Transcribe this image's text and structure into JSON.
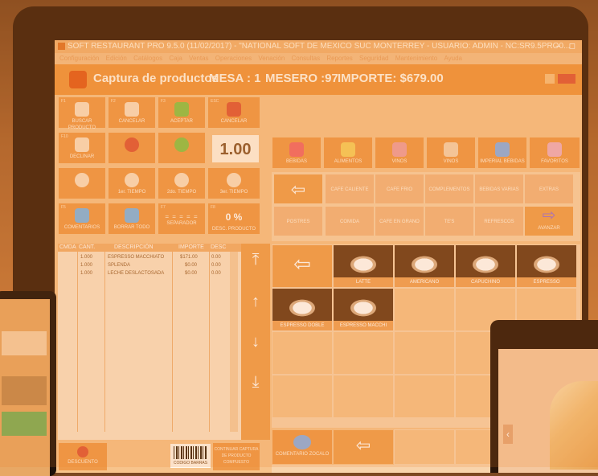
{
  "window": {
    "title": "SOFT RESTAURANT PRO 9.5.0 (11/02/2017) - \"NATIONAL SOFT DE MEXICO SUC MONTERREY - USUARIO: ADMIN  -  NC:SR9.5PRO0...",
    "controls": "– ◻"
  },
  "menu": [
    "Configuración",
    "Edición",
    "Catálogos",
    "Caja",
    "Ventas",
    "Operaciones",
    "Venación",
    "Consultas",
    "Reportes",
    "Seguridad",
    "Mantenimiento",
    "Ayuda"
  ],
  "header": {
    "title": "Captura de productos",
    "mesa": "MESA : 1",
    "mesero": "MESERO :97",
    "importe": "IMPORTE: $679.00"
  },
  "left_buttons": {
    "row1": [
      {
        "key": "F1",
        "label": "BUSCAR PRODUCTO",
        "icon": "document-search-icon"
      },
      {
        "key": "F2",
        "label": "CANCELAR",
        "icon": "document-icon"
      },
      {
        "key": "F3",
        "label": "ACEPTAR",
        "icon": "checkmark-icon"
      },
      {
        "key": "ESC",
        "label": "CANCELAR",
        "icon": "cross-icon"
      }
    ],
    "row2": [
      {
        "key": "F10",
        "label": "DECLINAR",
        "icon": "hand-icon"
      },
      {
        "key": "",
        "label": "",
        "icon": "minus-icon"
      },
      {
        "key": "",
        "label": "",
        "icon": "plus-icon"
      }
    ],
    "quantity": "1.00",
    "row3": [
      {
        "key": "",
        "label": "",
        "icon": "plate-icon"
      },
      {
        "key": "",
        "label": "1er. TIEMPO",
        "icon": "time-1-icon"
      },
      {
        "key": "",
        "label": "2do. TIEMPO",
        "icon": "time-2-icon"
      },
      {
        "key": "",
        "label": "3er. TIEMPO",
        "icon": "time-3-icon"
      }
    ],
    "row4": [
      {
        "key": "F5",
        "label": "COMENTARIOS",
        "icon": "eraser-icon"
      },
      {
        "key": "",
        "label": "BORRAR TODO",
        "icon": "eraser-icon"
      },
      {
        "key": "F7",
        "label": "SEPARADOR",
        "icon": "separator-icon"
      },
      {
        "key": "F8",
        "label": "DESC. PRODUCTO",
        "icon": "percent-icon"
      }
    ],
    "percent": "0 %",
    "separator_text": "= = = = ="
  },
  "order_table": {
    "headers": [
      "CMDA",
      "CANT.",
      "DESCRIPCIÓN",
      "IMPORTE",
      "DESC"
    ],
    "rows": [
      {
        "cant": "1.000",
        "desc": "ESPRESSO MACCHIATO",
        "importe": "$171.00",
        "descu": "0.00"
      },
      {
        "cant": "1.000",
        "desc": "SPLENDA",
        "importe": "$0.00",
        "descu": "0.00"
      },
      {
        "cant": "1.000",
        "desc": "LECHE DESLACTOSADA",
        "importe": "$0.00",
        "descu": "0.00"
      }
    ]
  },
  "groups": [
    "BEBIDAS",
    "ALIMENTOS",
    "VINOS",
    "VINOS",
    "IMPERIAL BEBIDAS",
    "FAVORITOS"
  ],
  "categories": {
    "row1": [
      "CAFE CALIENTE",
      "CAFE FRIO",
      "COMPLEMENTOS",
      "BEBIDAS VARIAS",
      "EXTRAS"
    ],
    "row2": [
      "POSTRES",
      "COMIDA",
      "CAFE EN GRANO",
      "TE'S",
      "REFRESCOS",
      "AVANZAR"
    ]
  },
  "products": [
    "LATTE",
    "AMERICANO",
    "CAPUCHINO",
    "ESPRESSO",
    "ESPRESSO DOBLE",
    "ESPRESSO MACCHI"
  ],
  "bottom_buttons": [
    "COMENTARIO ZOCALO"
  ],
  "footer": {
    "left_label": "DESCUENTO",
    "barcode_text": "CODIGO BARRAS",
    "right_label": "CONTINUAR CAPTURA DE PRODUCTO COMPUESTO"
  }
}
